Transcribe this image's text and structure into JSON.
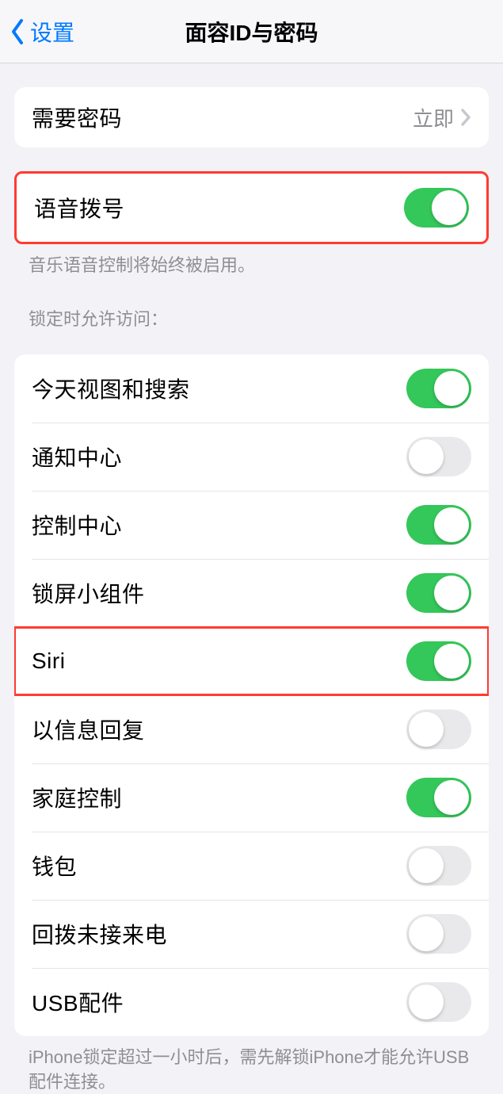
{
  "header": {
    "back_label": "设置",
    "title": "面容ID与密码"
  },
  "passcode_group": {
    "require_passcode": {
      "label": "需要密码",
      "value": "立即"
    }
  },
  "voice_dial": {
    "label": "语音拨号",
    "on": true,
    "footer": "音乐语音控制将始终被启用。"
  },
  "lock_section": {
    "header": "锁定时允许访问：",
    "items": [
      {
        "label": "今天视图和搜索",
        "on": true,
        "highlighted": false
      },
      {
        "label": "通知中心",
        "on": false,
        "highlighted": false
      },
      {
        "label": "控制中心",
        "on": true,
        "highlighted": false
      },
      {
        "label": "锁屏小组件",
        "on": true,
        "highlighted": false
      },
      {
        "label": "Siri",
        "on": true,
        "highlighted": true
      },
      {
        "label": "以信息回复",
        "on": false,
        "highlighted": false
      },
      {
        "label": "家庭控制",
        "on": true,
        "highlighted": false
      },
      {
        "label": "钱包",
        "on": false,
        "highlighted": false
      },
      {
        "label": "回拨未接来电",
        "on": false,
        "highlighted": false
      },
      {
        "label": "USB配件",
        "on": false,
        "highlighted": false
      }
    ],
    "footer": "iPhone锁定超过一小时后，需先解锁iPhone才能允许USB配件连接。"
  }
}
